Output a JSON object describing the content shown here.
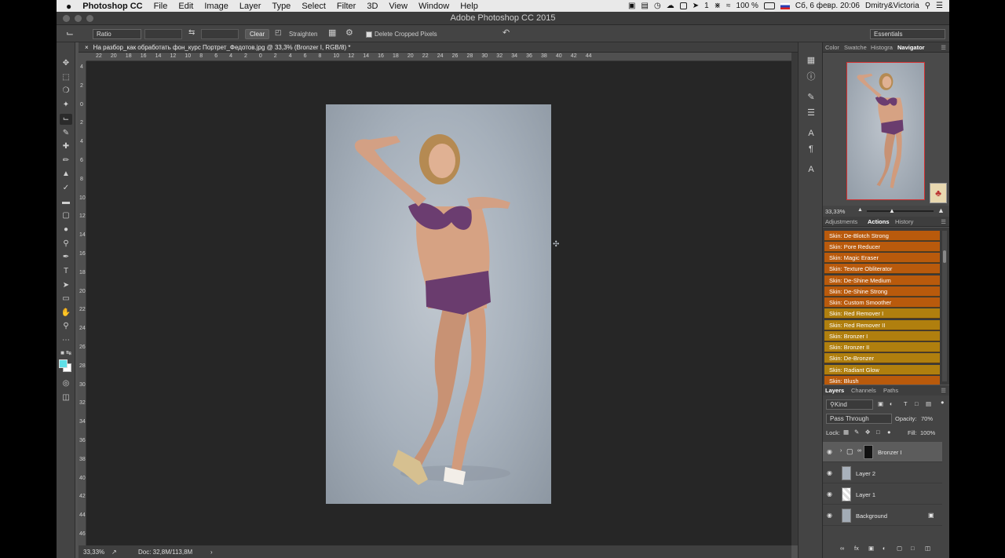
{
  "menubar": {
    "apple": "",
    "app_name": "Photoshop CC",
    "items": [
      "File",
      "Edit",
      "Image",
      "Layer",
      "Type",
      "Select",
      "Filter",
      "3D",
      "View",
      "Window",
      "Help"
    ],
    "battery": "100 %",
    "datetime": "Сб, 6 февр.  20:06",
    "user": "Dmitry&Victoria",
    "wifi_count": "1"
  },
  "window": {
    "title": "Adobe Photoshop CC 2015"
  },
  "options": {
    "ratio": "Ratio",
    "clear": "Clear",
    "straighten": "Straighten",
    "delete_cropped": "Delete Cropped Pixels",
    "workspace": "Essentials"
  },
  "document": {
    "tab_title": "На разбор_как обработать фон_курс Портрет_Федотов.jpg @ 33,3% (Bronzer I, RGB/8) *",
    "zoom": "33,33%",
    "doc_size": "Doc: 32,8M/113,8M"
  },
  "rulers": {
    "h": [
      "22",
      "20",
      "18",
      "16",
      "14",
      "12",
      "10",
      "8",
      "6",
      "4",
      "2",
      "0",
      "2",
      "4",
      "6",
      "8",
      "10",
      "12",
      "14",
      "16",
      "18",
      "20",
      "22",
      "24",
      "26",
      "28",
      "30",
      "32",
      "34",
      "36",
      "38",
      "40",
      "42",
      "44"
    ],
    "v": [
      "4",
      "2",
      "0",
      "2",
      "4",
      "6",
      "8",
      "10",
      "12",
      "14",
      "16",
      "18",
      "20",
      "22",
      "24",
      "26",
      "28",
      "30",
      "32",
      "34",
      "36",
      "38",
      "40",
      "42",
      "44",
      "46"
    ]
  },
  "panel_tabs_top": {
    "color": "Color",
    "swatches": "Swatche",
    "histogram": "Histogra",
    "navigator": "Navigator"
  },
  "navigator": {
    "zoom": "33,33%"
  },
  "panel_tabs_mid": {
    "adjustments": "Adjustments",
    "actions": "Actions",
    "history": "History"
  },
  "actions": [
    {
      "label": "Skin: De-Blotch Strong",
      "color": "#b95a0c"
    },
    {
      "label": "Skin: Pore Reducer",
      "color": "#b95a0c"
    },
    {
      "label": "Skin: Magic Eraser",
      "color": "#b95a0c"
    },
    {
      "label": "Skin: Texture Obliterator",
      "color": "#b95a0c"
    },
    {
      "label": "Skin: De-Shine Medium",
      "color": "#b95a0c"
    },
    {
      "label": "Skin: De-Shine Strong",
      "color": "#b95a0c"
    },
    {
      "label": "Skin: Custom Smoother",
      "color": "#b95a0c"
    },
    {
      "label": "Skin: Red Remover I",
      "color": "#b07f0e"
    },
    {
      "label": "Skin: Red Remover II",
      "color": "#b07f0e"
    },
    {
      "label": "Skin: Bronzer I",
      "color": "#b07f0e"
    },
    {
      "label": "Skin: Bronzer II",
      "color": "#b07f0e"
    },
    {
      "label": "Skin: De-Bronzer",
      "color": "#b07f0e"
    },
    {
      "label": "Skin: Radiant Glow",
      "color": "#b07f0e"
    },
    {
      "label": "Skin: Blush",
      "color": "#b95a0c"
    }
  ],
  "panel_tabs_bottom": {
    "layers": "Layers",
    "channels": "Channels",
    "paths": "Paths"
  },
  "layers_panel": {
    "filter": "Kind",
    "blend": "Pass Through",
    "opacity_label": "Opacity:",
    "opacity": "70%",
    "lock_label": "Lock:",
    "fill_label": "Fill:",
    "fill": "100%"
  },
  "layers": [
    {
      "name": "Bronzer I",
      "type": "group"
    },
    {
      "name": "Layer 2",
      "type": "pixel"
    },
    {
      "name": "Layer 1",
      "type": "pixel"
    },
    {
      "name": "Background",
      "type": "background"
    }
  ],
  "colors": {
    "foreground": "#5fe0e8",
    "background": "#ffffff",
    "accent": "#d23030"
  }
}
